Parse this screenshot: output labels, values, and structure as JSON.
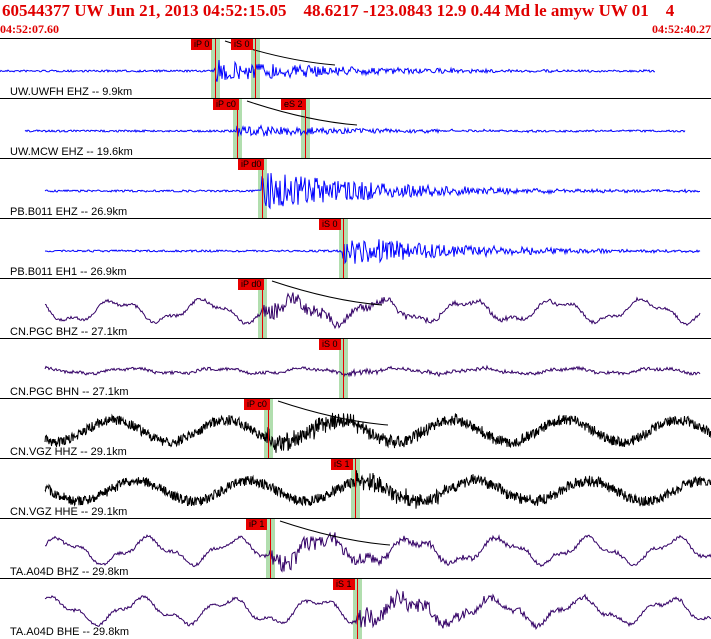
{
  "header": {
    "title": "60544377 UW Jun 21, 2013 04:52:15.05    48.6217 -123.0843 12.9 0.44 Md le amyw UW 01    4",
    "time_start": "04:52:07.60",
    "time_end": "04:52:40.27"
  },
  "colors": {
    "accent": "#e80000",
    "pick_window": "#9ed69a"
  },
  "traces": [
    {
      "label": "UW.UWFH EHZ -- 9.9km",
      "color": "#0000ff",
      "picks": [
        {
          "text": "iP 0"
        },
        {
          "text": "iS 0"
        }
      ]
    },
    {
      "label": "UW.MCW EHZ -- 19.6km",
      "color": "#0000ff",
      "picks": [
        {
          "text": "iP c0"
        },
        {
          "text": "eS 2"
        }
      ]
    },
    {
      "label": "PB.B011 EHZ -- 26.9km",
      "color": "#0000ff",
      "picks": [
        {
          "text": "iP d0"
        }
      ]
    },
    {
      "label": "PB.B011 EH1 -- 26.9km",
      "color": "#0000ff",
      "picks": [
        {
          "text": "iS 0"
        }
      ]
    },
    {
      "label": "CN.PGC BHZ -- 27.1km",
      "color": "#330066",
      "picks": [
        {
          "text": "iP d0"
        }
      ]
    },
    {
      "label": "CN.PGC BHN -- 27.1km",
      "color": "#330066",
      "picks": [
        {
          "text": "iS 0"
        }
      ]
    },
    {
      "label": "CN.VGZ HHZ -- 29.1km",
      "color": "#000000",
      "picks": [
        {
          "text": "iP c0"
        }
      ]
    },
    {
      "label": "CN.VGZ HHE -- 29.1km",
      "color": "#000000",
      "picks": [
        {
          "text": "iS 1"
        }
      ]
    },
    {
      "label": "TA.A04D BHZ -- 29.8km",
      "color": "#330066",
      "picks": [
        {
          "text": "iP 1"
        }
      ]
    },
    {
      "label": "TA.A04D BHE -- 29.8km",
      "color": "#330066",
      "picks": [
        {
          "text": "iS 1"
        }
      ]
    }
  ]
}
